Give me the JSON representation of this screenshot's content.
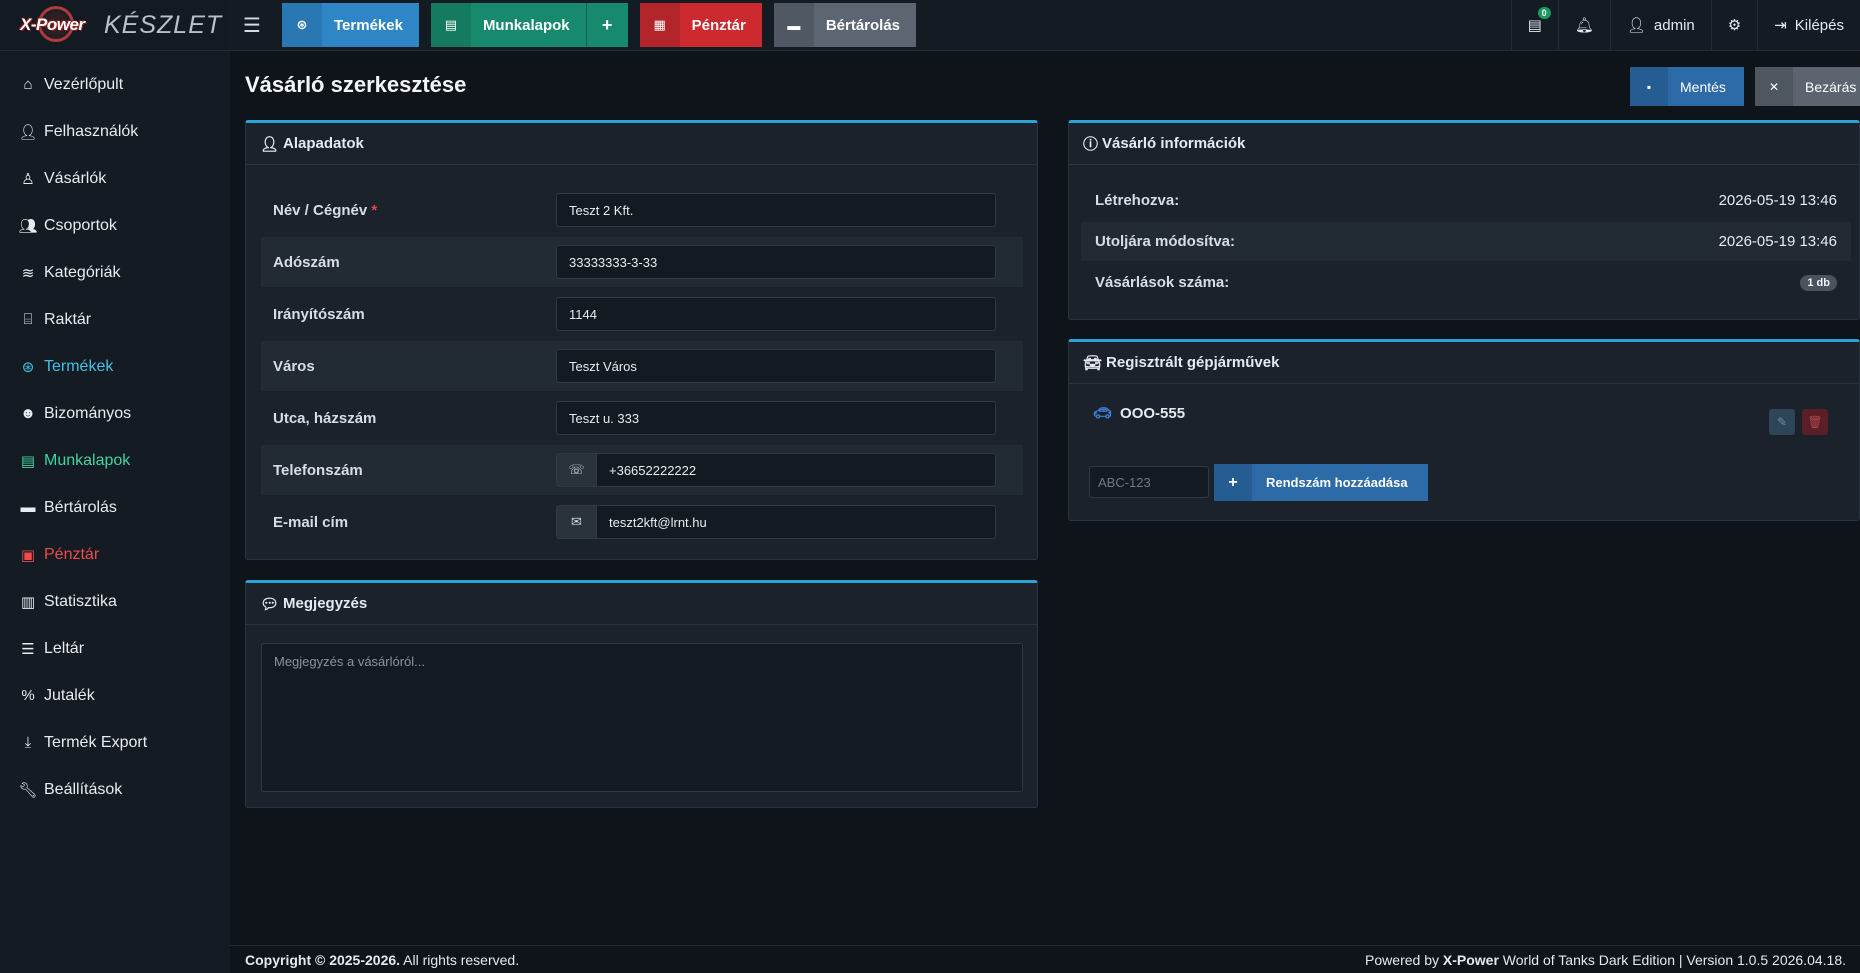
{
  "brand": {
    "logo_text": "X-Power",
    "word": "KÉSZLET"
  },
  "topbar": {
    "quick_buttons": [
      {
        "label": "Termékek"
      },
      {
        "label": "Munkalapok",
        "plus": "+"
      },
      {
        "label": "Pénztár"
      },
      {
        "label": "Bértárolás"
      }
    ],
    "notif_count": "0",
    "user": "admin",
    "logout": "Kilépés"
  },
  "sidebar": {
    "items": [
      {
        "label": "Vezérlőpult",
        "icon": "home-icon"
      },
      {
        "label": "Felhasználók",
        "icon": "user-icon"
      },
      {
        "label": "Vásárlók",
        "icon": "user-outline-icon"
      },
      {
        "label": "Csoportok",
        "icon": "users-icon"
      },
      {
        "label": "Kategóriák",
        "icon": "layers-icon"
      },
      {
        "label": "Raktár",
        "icon": "warehouse-icon"
      },
      {
        "label": "Termékek",
        "icon": "lifebuoy-icon"
      },
      {
        "label": "Bizományos",
        "icon": "user-circle-icon"
      },
      {
        "label": "Munkalapok",
        "icon": "file-icon"
      },
      {
        "label": "Bértárolás",
        "icon": "archive-icon"
      },
      {
        "label": "Pénztár",
        "icon": "money-icon"
      },
      {
        "label": "Statisztika",
        "icon": "chart-icon"
      },
      {
        "label": "Leltár",
        "icon": "list-icon"
      },
      {
        "label": "Jutalék",
        "icon": "percent-icon"
      },
      {
        "label": "Termék Export",
        "icon": "download-icon"
      },
      {
        "label": "Beállítások",
        "icon": "wrench-icon"
      }
    ]
  },
  "page": {
    "title": "Vásárló szerkesztése",
    "save_label": "Mentés",
    "close_label": "Bezárás"
  },
  "basic": {
    "title": "Alapadatok",
    "fields": [
      {
        "label": "Név / Cégnév",
        "required": "*",
        "value": "Teszt 2 Kft."
      },
      {
        "label": "Adószám",
        "value": "33333333-3-33"
      },
      {
        "label": "Irányítószám",
        "value": "1144"
      },
      {
        "label": "Város",
        "value": "Teszt Város"
      },
      {
        "label": "Utca, házszám",
        "value": "Teszt u. 333"
      },
      {
        "label": "Telefonszám",
        "value": "+36652222222"
      },
      {
        "label": "E-mail cím",
        "value": "teszt2kft@lrnt.hu"
      }
    ]
  },
  "note": {
    "title": "Megjegyzés",
    "placeholder": "Megjegyzés a vásárlóról..."
  },
  "info": {
    "title": "Vásárló információk",
    "rows": [
      {
        "key": "Létrehozva:",
        "value": "2026-05-19 13:46"
      },
      {
        "key": "Utoljára módosítva:",
        "value": "2026-05-19 13:46"
      },
      {
        "key": "Vásárlások száma:",
        "value": "1 db"
      }
    ]
  },
  "vehicles": {
    "title": "Regisztrált gépjárművek",
    "plate": "OOO-555",
    "placeholder": "ABC-123",
    "add_label": "Rendszám hozzáadása"
  },
  "footer": {
    "copyright_bold": "Copyright © 2025-2026.",
    "copyright_rest": " All rights reserved.",
    "powered_pre": "Powered by ",
    "powered_brand": "X-Power",
    "powered_rest": " World of Tanks Dark Edition | Version 1.0.5 2026.04.18."
  }
}
